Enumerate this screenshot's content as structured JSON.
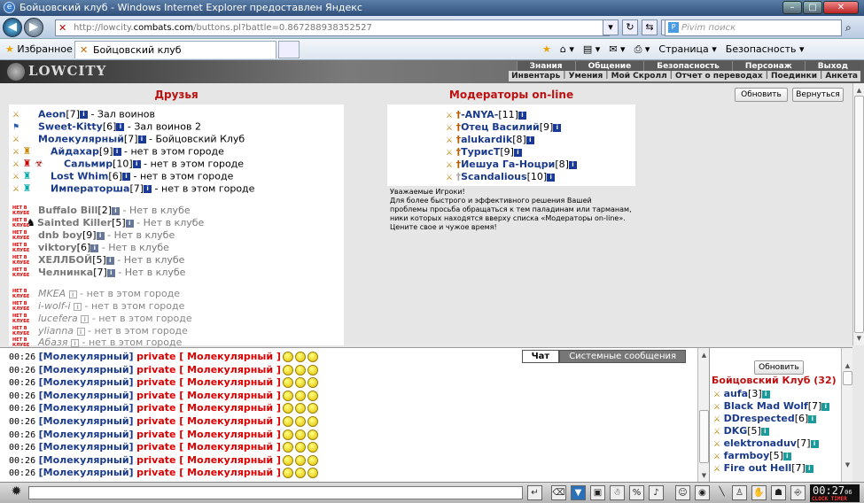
{
  "window": {
    "title": "Бойцовский клуб - Windows Internet Explorer предоставлен Яндекс"
  },
  "address": {
    "url_prefix": "http://lowcity.",
    "url_domain": "combats.com",
    "url_rest": "/buttons.pl?battle=0.867288938352527",
    "search_placeholder": "Pivim поиск"
  },
  "favbar": {
    "favorites": "Избранное",
    "tab_title": "Бойцовский клуб",
    "page_menu": "Страница ▾",
    "security_menu": "Безопасность ▾"
  },
  "game": {
    "logo": "LOWCITY",
    "menu_top": [
      "Знания",
      "Общение",
      "Безопасность",
      "Персонаж",
      "Выход"
    ],
    "menu_bottom": [
      "Инвентарь",
      "Умения",
      "Мой Скролл",
      "Отчет о переводах",
      "Поединки",
      "Анкета"
    ]
  },
  "friends": {
    "title": "Друзья",
    "rows": [
      {
        "name": "Aeon",
        "level": "[7]",
        "status": " - Зал воинов"
      },
      {
        "name": "Sweet-Kitty",
        "level": "[6]",
        "status": " - Зал воинов 2"
      },
      {
        "name": "Молекулярный",
        "level": "[7]",
        "status": " - Бойцовский Клуб"
      },
      {
        "name": "Айдахар",
        "level": "[9]",
        "status": " - нет в этом городе"
      },
      {
        "name": "Сальмир",
        "level": "[10]",
        "status": " - нет в этом городе"
      },
      {
        "name": "Lost Whim",
        "level": "[6]",
        "status": " - нет в этом городе"
      },
      {
        "name": "Императорша",
        "level": "[7]",
        "status": " - нет в этом городе"
      }
    ],
    "offline": [
      {
        "name": "Buffalo Bill",
        "level": "[2]",
        "status": " - Нет в клубе"
      },
      {
        "name": "Sainted Killer",
        "level": "[5]",
        "status": " - Нет в клубе"
      },
      {
        "name": "dnb boy",
        "level": "[9]",
        "status": " - Нет в клубе"
      },
      {
        "name": "viktory",
        "level": "[6]",
        "status": " - Нет в клубе"
      },
      {
        "name": "ХЕЛЛБОЙ",
        "level": "[5]",
        "status": " - Нет в клубе"
      },
      {
        "name": "Челнинка",
        "level": "[7]",
        "status": " - Нет в клубе"
      }
    ],
    "other_city": [
      {
        "name": "MKEA",
        "status": " - нет в этом городе"
      },
      {
        "name": "i-wolf-i",
        "status": " - нет в этом городе"
      },
      {
        "name": "lucefera",
        "status": " - нет в этом городе"
      },
      {
        "name": "ylianna",
        "status": " - нет в этом городе"
      },
      {
        "name": "Абазя",
        "status": " - нет в этом городе"
      }
    ],
    "red_label": "НЕТ В КЛУБЕ"
  },
  "moderators": {
    "title": "Модераторы on-line",
    "rows": [
      {
        "name": "-ANYA-",
        "level": "[11]"
      },
      {
        "name": "Отец Василий",
        "level": "[9]"
      },
      {
        "name": "alukardik",
        "level": "[8]"
      },
      {
        "name": "ТурисТ",
        "level": "[9]"
      },
      {
        "name": "Иешуа Га-Ноцри",
        "level": "[8]"
      },
      {
        "name": "Scandalious",
        "level": "[10]"
      }
    ],
    "notice": [
      "Уважаемые Игроки!",
      "Для более быстрого и эффективного решения Вашей",
      "проблемы просьба обращаться к тем паладинам или тарманам,",
      "ники которых находятся вверху списка «Модераторы on-line».",
      "Цените свое и чужое время!"
    ]
  },
  "buttons": {
    "refresh": "Обновить",
    "back": "Вернуться",
    "refresh2": "Обновить"
  },
  "chat": {
    "tab_chat": "Чат",
    "tab_system": "Системные сообщения",
    "rows": [
      {
        "time": "00:26",
        "name": "[Молекулярный]",
        "text": "private [ Молекулярный ]"
      },
      {
        "time": "00:26",
        "name": "[Молекулярный]",
        "text": "private [ Молекулярный ]"
      },
      {
        "time": "00:26",
        "name": "[Молекулярный]",
        "text": "private [ Молекулярный ]"
      },
      {
        "time": "00:26",
        "name": "[Молекулярный]",
        "text": "private [ Молекулярный ]"
      },
      {
        "time": "00:26",
        "name": "[Молекулярный]",
        "text": "private [ Молекулярный ]"
      },
      {
        "time": "00:26",
        "name": "[Молекулярный]",
        "text": "private [ Молекулярный ]"
      },
      {
        "time": "00:26",
        "name": "[Молекулярный]",
        "text": "private [ Молекулярный ]"
      },
      {
        "time": "00:26",
        "name": "[Молекулярный]",
        "text": "private [ Молекулярный ]"
      },
      {
        "time": "00:26",
        "name": "[Молекулярный]",
        "text": "private [ Молекулярный ]"
      },
      {
        "time": "00:26",
        "name": "[Молекулярный]",
        "text": "private [ Молекулярный ]"
      }
    ]
  },
  "online": {
    "title": "Бойцовский Клуб (32)",
    "rows": [
      {
        "name": "aufa",
        "level": "[3]"
      },
      {
        "name": "Black Mad Wolf",
        "level": "[7]"
      },
      {
        "name": "DDrespected",
        "level": "[6]"
      },
      {
        "name": "DKG",
        "level": "[5]"
      },
      {
        "name": "elektronaduv",
        "level": "[7]"
      },
      {
        "name": "farmboy",
        "level": "[5]"
      },
      {
        "name": "Fire out Hell",
        "level": "[7]"
      }
    ]
  },
  "clock": {
    "time": "00:27",
    "sec": "06",
    "label": "CLOCK TIMER"
  }
}
